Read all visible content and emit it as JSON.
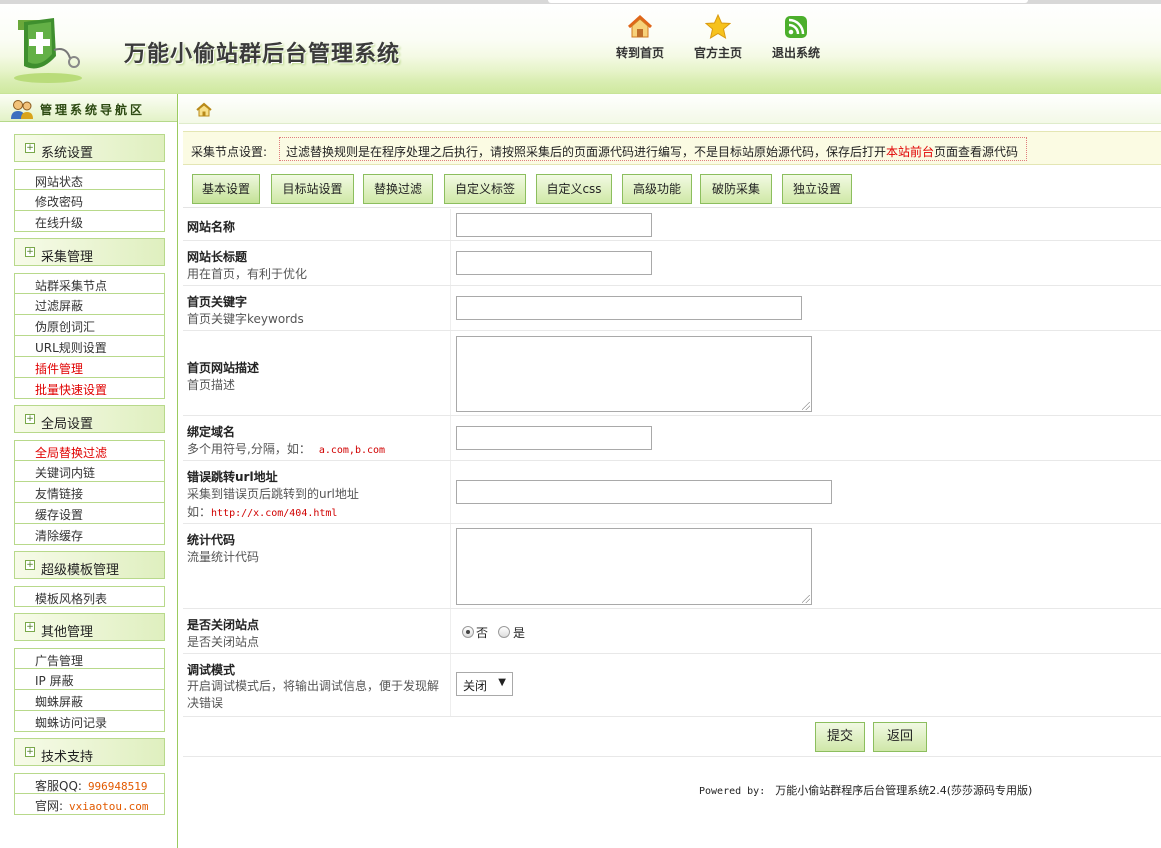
{
  "header": {
    "title": "万能小偷站群后台管理系统",
    "nav": [
      {
        "label": "转到首页",
        "icon": "home-icon"
      },
      {
        "label": "官方主页",
        "icon": "star-icon"
      },
      {
        "label": "退出系统",
        "icon": "rss-icon"
      }
    ]
  },
  "sidebar": {
    "title": "管理系统导航区",
    "groups": [
      {
        "label": "系统设置",
        "items": [
          {
            "label": "网站状态"
          },
          {
            "label": "修改密码"
          },
          {
            "label": "在线升级"
          }
        ]
      },
      {
        "label": "采集管理",
        "items": [
          {
            "label": "站群采集节点"
          },
          {
            "label": "过滤屏蔽"
          },
          {
            "label": "伪原创词汇"
          },
          {
            "label": "URL规则设置"
          },
          {
            "label": "插件管理"
          },
          {
            "label": "批量快速设置"
          }
        ]
      },
      {
        "label": "全局设置",
        "items": [
          {
            "label": "全局替换过滤"
          },
          {
            "label": "关键词内链"
          },
          {
            "label": "友情链接"
          },
          {
            "label": "缓存设置"
          },
          {
            "label": "清除缓存"
          }
        ]
      },
      {
        "label": "超级模板管理",
        "items": [
          {
            "label": "模板风格列表"
          }
        ]
      },
      {
        "label": "其他管理",
        "items": [
          {
            "label": "广告管理"
          },
          {
            "label": "IP 屏蔽"
          },
          {
            "label": "蜘蛛屏蔽"
          },
          {
            "label": "蜘蛛访问记录"
          }
        ]
      },
      {
        "label": "技术支持",
        "items": [
          {
            "label": "客服QQ:",
            "value": "996948519"
          },
          {
            "label": "官网:",
            "value": "vxiaotou.com"
          }
        ]
      }
    ]
  },
  "notice": {
    "label": "采集节点设置:",
    "text_before": "过滤替换规则是在程序处理之后执行，请按照采集后的页面源代码进行编写，不是目标站原始源代码，保存后打开",
    "link": "本站前台",
    "text_after": "页面查看源代码"
  },
  "tabs": [
    "基本设置",
    "目标站设置",
    "替换过滤",
    "自定义标签",
    "自定义css",
    "高级功能",
    "破防采集",
    "独立设置"
  ],
  "form": {
    "site_name": {
      "label": "网站名称",
      "value": ""
    },
    "long_title": {
      "label": "网站长标题",
      "desc": "用在首页，有利于优化",
      "value": ""
    },
    "keywords": {
      "label": "首页关键字",
      "desc": "首页关键字keywords",
      "value": ""
    },
    "description": {
      "label": "首页网站描述",
      "desc": "首页描述",
      "value": ""
    },
    "domain": {
      "label": "绑定域名",
      "desc": "多个用符号,分隔，如：",
      "example": "a.com,b.com",
      "value": ""
    },
    "error_url": {
      "label": "错误跳转url地址",
      "desc": "采集到错误页后跳转到的url地址",
      "example_prefix": "如：",
      "example": "http://x.com/404.html",
      "value": ""
    },
    "stats": {
      "label": "统计代码",
      "desc": "流量统计代码",
      "value": ""
    },
    "close_site": {
      "label": "是否关闭站点",
      "desc": "是否关闭站点",
      "options": [
        "否",
        "是"
      ],
      "selected": "否"
    },
    "debug": {
      "label": "调试模式",
      "desc": "开启调试模式后，将输出调试信息，便于发现解决错误",
      "selected": "关闭"
    }
  },
  "buttons": {
    "submit": "提交",
    "back": "返回"
  },
  "footer": {
    "powered": "Powered by:",
    "text": "万能小偷站群程序后台管理系统2.4(莎莎源码专用版)"
  },
  "colors": {
    "accent_green": "#8cbe5e",
    "link_red": "#e00000",
    "value_orange": "#e25a00"
  }
}
